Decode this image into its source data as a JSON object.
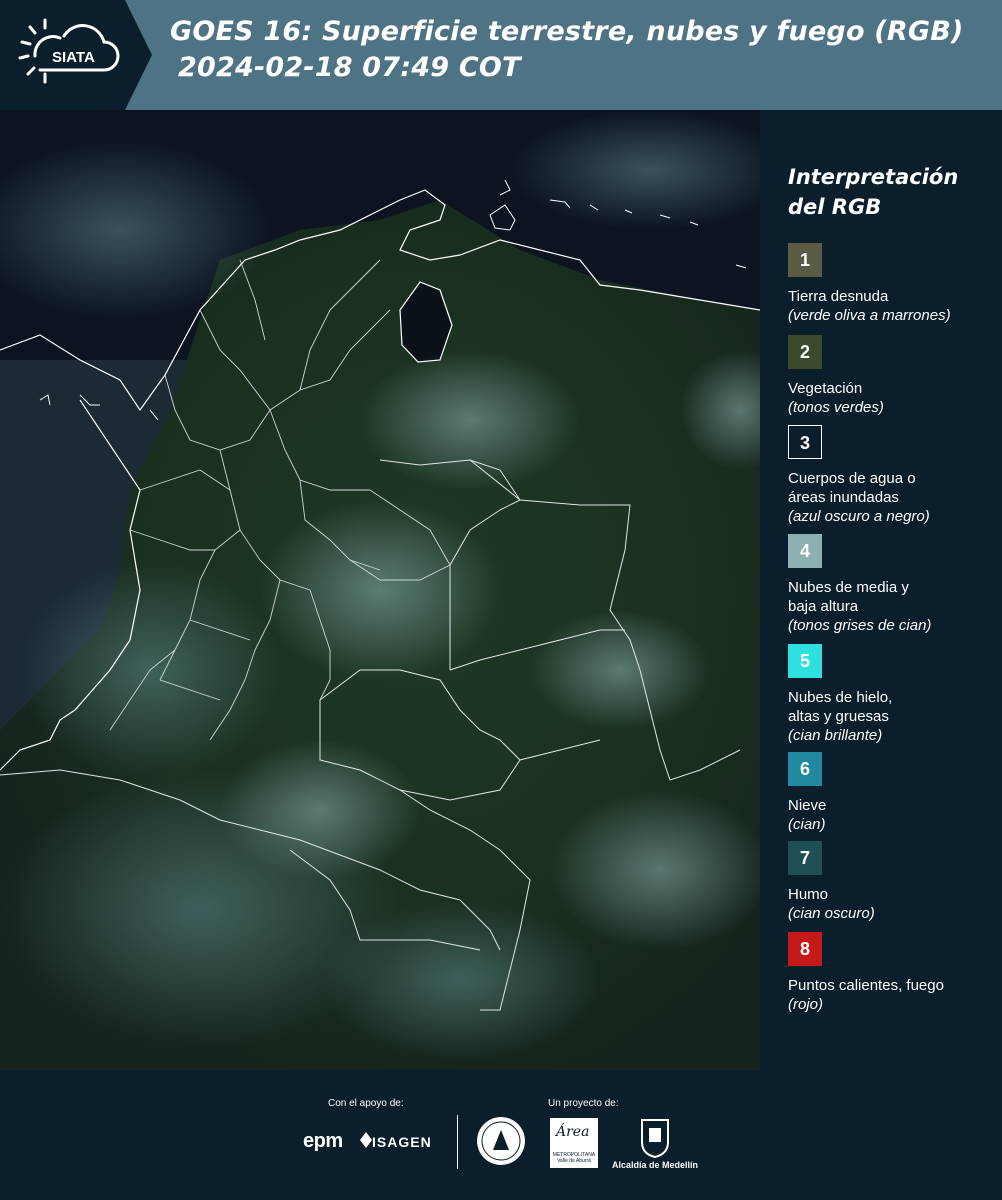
{
  "header": {
    "logo_text": "SIATA",
    "title_line1": "GOES 16: Superficie terrestre, nubes y fuego (RGB)",
    "title_line2": "2024-02-18 07:49 COT"
  },
  "legend": {
    "title_line1": "Interpretación",
    "title_line2": "del RGB",
    "items": [
      {
        "number": "1",
        "color": "#5b5a45",
        "label": "Tierra desnuda",
        "sub": "(verde oliva a marrones)"
      },
      {
        "number": "2",
        "color": "#3a4a2a",
        "label": "Vegetación",
        "sub": "(tonos verdes)"
      },
      {
        "number": "3",
        "color": "#0b1e2b",
        "label": "Cuerpos de agua o áreas inundadas",
        "sub": "(azul oscuro a negro)"
      },
      {
        "number": "4",
        "color": "#8db0b0",
        "label": "Nubes de media y baja altura",
        "sub": "(tonos grises de cian)"
      },
      {
        "number": "5",
        "color": "#2ee0e0",
        "label": "Nubes de hielo, altas y gruesas",
        "sub": "(cian brillante)"
      },
      {
        "number": "6",
        "color": "#1f8aa0",
        "label": "Nieve",
        "sub": "(cian)"
      },
      {
        "number": "7",
        "color": "#1e4f55",
        "label": "Humo",
        "sub": "(cian oscuro)"
      },
      {
        "number": "8",
        "color": "#c41a1a",
        "label": "Puntos calientes, fuego",
        "sub": "(rojo)"
      }
    ]
  },
  "footer": {
    "support_label": "Con el apoyo de:",
    "project_label": "Un proyecto de:",
    "epm": "epm",
    "isagen": "ISAGEN",
    "area_text": "Área",
    "area_sub": "METROPOLITANA Valle de Aburrá",
    "medellin": "Alcaldía de Medellín"
  }
}
